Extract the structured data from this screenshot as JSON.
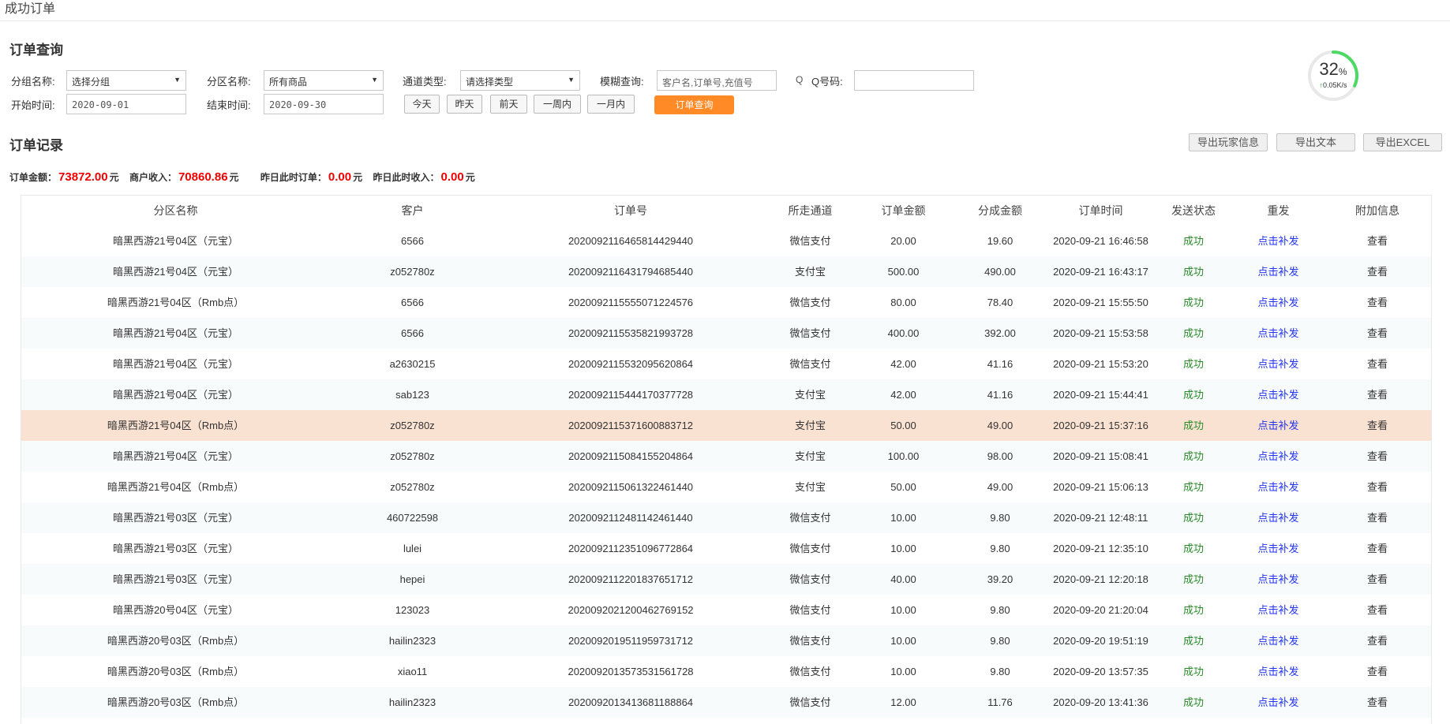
{
  "breadcrumb": "成功订单",
  "query": {
    "title": "订单查询",
    "group_label": "分组名称:",
    "group_value": "选择分组",
    "zone_label": "分区名称:",
    "zone_value": "所有商品",
    "channel_label": "通道类型:",
    "channel_value": "请选择类型",
    "fuzzy_label": "模糊查询:",
    "fuzzy_placeholder": "客户名,订单号,充值号",
    "qq_icon": "Q",
    "qq_label": "Q号码:",
    "qq_value": "",
    "start_label": "开始时间:",
    "start_value": "2020-09-01",
    "end_label": "结束时间:",
    "end_value": "2020-09-30",
    "quick": [
      "今天",
      "昨天",
      "前天",
      "一周内",
      "一月内"
    ],
    "search_button": "订单查询"
  },
  "records": {
    "title": "订单记录",
    "export_buttons": [
      "导出玩家信息",
      "导出文本",
      "导出EXCEL"
    ]
  },
  "stats": {
    "order_amount_label": "订单金额：",
    "order_amount": "73872.00",
    "merchant_income_label": "商户收入：",
    "merchant_income": "70860.86",
    "yesterday_orders_label": "昨日此时订单：",
    "yesterday_orders": "0.00",
    "yesterday_income_label": "昨日此时收入：",
    "yesterday_income": "0.00",
    "unit": "元"
  },
  "monitor": {
    "percent": 32,
    "percent_text": "32",
    "percent_unit": "%",
    "arrow": "↑",
    "speed": "0.05K/s",
    "colors": {
      "track": "#e8e8e8",
      "progress": "#4cd964"
    }
  },
  "table": {
    "columns": [
      "分区名称",
      "客户",
      "订单号",
      "所走通道",
      "订单金额",
      "分成金额",
      "订单时间",
      "发送状态",
      "重发",
      "附加信息"
    ],
    "rows": [
      [
        "暗黑西游21号04区（元宝）",
        "6566",
        "202009211646581442944 0",
        "微信支付",
        "20.00",
        "19.60",
        "2020-09-21 16:46:58",
        "成功",
        "点击补发",
        "查看"
      ],
      [
        "暗黑西游21号04区（元宝）",
        "z052780z",
        "20200921164317946854 40",
        "支付宝",
        "500.00",
        "490.00",
        "2020-09-21 16:43:17",
        "成功",
        "点击补发",
        "查看"
      ],
      [
        "暗黑西游21号04区（Rmb点）",
        "6566",
        "202009211555507122457 6",
        "微信支付",
        "80.00",
        "78.40",
        "2020-09-21 15:55:50",
        "成功",
        "点击补发",
        "查看"
      ],
      [
        "暗黑西游21号04区（元宝）",
        "6566",
        "202009211553582199372 8",
        "微信支付",
        "400.00",
        "392.00",
        "2020-09-21 15:53:58",
        "成功",
        "点击补发",
        "查看"
      ],
      [
        "暗黑西游21号04区（元宝）",
        "a2630215",
        "202009211553209562086 4",
        "微信支付",
        "42.00",
        "41.16",
        "2020-09-21 15:53:20",
        "成功",
        "点击补发",
        "查看"
      ],
      [
        "暗黑西游21号04区（元宝）",
        "sab123",
        "202009211544417037772 8",
        "支付宝",
        "42.00",
        "41.16",
        "2020-09-21 15:44:41",
        "成功",
        "点击补发",
        "查看"
      ],
      [
        "暗黑西游21号04区（Rmb点）",
        "z052780z",
        "202009211537160088371 2",
        "支付宝",
        "50.00",
        "49.00",
        "2020-09-21 15:37:16",
        "成功",
        "点击补发",
        "查看"
      ],
      [
        "暗黑西游21号04区（元宝）",
        "z052780z",
        "202009211508415520486 4",
        "支付宝",
        "100.00",
        "98.00",
        "2020-09-21 15:08:41",
        "成功",
        "点击补发",
        "查看"
      ],
      [
        "暗黑西游21号04区（Rmb点）",
        "z052780z",
        "202009211506132246144 0",
        "支付宝",
        "50.00",
        "49.00",
        "2020-09-21 15:06:13",
        "成功",
        "点击补发",
        "查看"
      ],
      [
        "暗黑西游21号03区（元宝）",
        "460722598",
        "202009211248114246144 0",
        "微信支付",
        "10.00",
        "9.80",
        "2020-09-21 12:48:11",
        "成功",
        "点击补发",
        "查看"
      ],
      [
        "暗黑西游21号03区（元宝）",
        "lulei",
        "202009211235109677286 4",
        "微信支付",
        "10.00",
        "9.80",
        "2020-09-21 12:35:10",
        "成功",
        "点击补发",
        "查看"
      ],
      [
        "暗黑西游21号03区（元宝）",
        "hepei",
        "202009211220183765171 2",
        "微信支付",
        "40.00",
        "39.20",
        "2020-09-21 12:20:18",
        "成功",
        "点击补发",
        "查看"
      ],
      [
        "暗黑西游20号04区（元宝）",
        "123023",
        "202009202120046276915 2",
        "微信支付",
        "10.00",
        "9.80",
        "2020-09-20 21:20:04",
        "成功",
        "点击补发",
        "查看"
      ],
      [
        "暗黑西游20号03区（Rmb点）",
        "hailin2323",
        "202009201951195973171 2",
        "微信支付",
        "10.00",
        "9.80",
        "2020-09-20 19:51:19",
        "成功",
        "点击补发",
        "查看"
      ],
      [
        "暗黑西游20号03区（Rmb点）",
        "xiao11",
        "202009201357353156172 8",
        "微信支付",
        "10.00",
        "9.80",
        "2020-09-20 13:57:35",
        "成功",
        "点击补发",
        "查看"
      ],
      [
        "暗黑西游20号03区（Rmb点）",
        "hailin2323",
        "202009201341368118886 4",
        "微信支付",
        "12.00",
        "11.76",
        "2020-09-20 13:41:36",
        "成功",
        "点击补发",
        "查看"
      ]
    ],
    "highlight_row": 6,
    "colors": {
      "highlight": "#fae2d3",
      "success": "#2a8a2a",
      "link": "#2233ee"
    }
  }
}
